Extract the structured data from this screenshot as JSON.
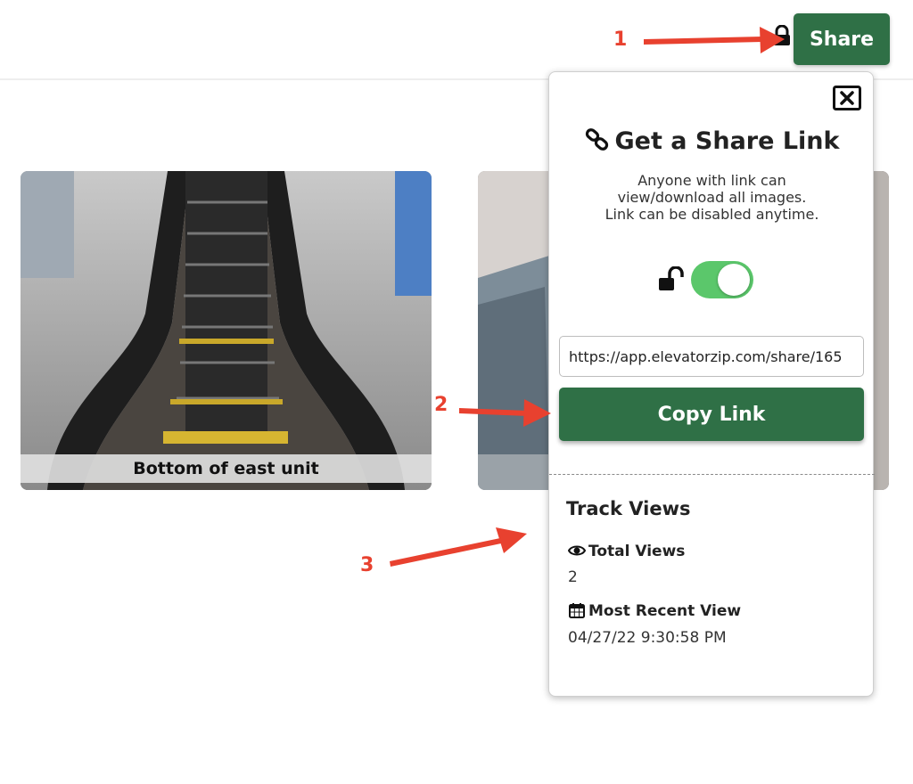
{
  "header": {
    "share_button_label": "Share"
  },
  "annotations": {
    "marker_1": "1",
    "marker_2": "2",
    "marker_3": "3"
  },
  "gallery": {
    "cards": [
      {
        "caption": "Bottom of east unit"
      },
      {
        "caption": ""
      }
    ]
  },
  "share_popover": {
    "title": "Get a Share Link",
    "description_lines": [
      "Anyone with link can",
      "view/download all images.",
      "Link can be disabled anytime."
    ],
    "sharing_enabled": true,
    "link_value": "https://app.elevatorzip.com/share/165",
    "copy_button_label": "Copy Link",
    "track_views": {
      "title": "Track Views",
      "total_views_label": "Total Views",
      "total_views_value": "2",
      "most_recent_label": "Most Recent View",
      "most_recent_value": "04/27/22 9:30:58 PM"
    }
  },
  "icons": {
    "close": "close-icon",
    "link": "link-icon",
    "unlock": "unlock-icon",
    "eye": "eye-icon",
    "calendar": "calendar-icon"
  },
  "colors": {
    "brand_green": "#2f7046",
    "toggle_on": "#5bc76b",
    "annotation_red": "#e8412f"
  }
}
